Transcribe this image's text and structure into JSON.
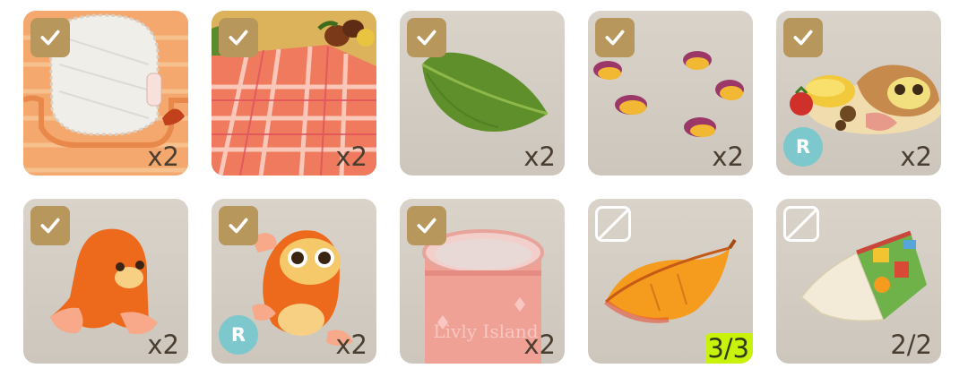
{
  "items": [
    {
      "name": "Lace Tablecloth Rug",
      "count": "x2",
      "collected": true,
      "badge": null
    },
    {
      "name": "Plaid Picnic Blanket",
      "count": "x2",
      "collected": true,
      "badge": null
    },
    {
      "name": "Green Leaf",
      "count": "x2",
      "collected": true,
      "badge": null
    },
    {
      "name": "Sweet Potato Slices",
      "count": "x2",
      "collected": true,
      "badge": null
    },
    {
      "name": "Autumn Feast Plate",
      "count": "x2",
      "collected": true,
      "badge": "R"
    },
    {
      "name": "Orange Blob Critter",
      "count": "x2",
      "collected": true,
      "badge": null
    },
    {
      "name": "Orange Squirrel Critter",
      "count": "x2",
      "collected": true,
      "badge": "R"
    },
    {
      "name": "Livly Island Jar",
      "count": "x2",
      "collected": true,
      "badge": null,
      "jar_text": "Livly Island"
    },
    {
      "name": "Autumn Orange Leaf",
      "count": "3/3",
      "collected": false,
      "badge": null,
      "highlight": true
    },
    {
      "name": "Open Picture Book",
      "count": "2/2",
      "collected": false,
      "badge": null
    }
  ],
  "colors": {
    "tile_bg": "#d4cdc3",
    "check_bg": "#b8975c",
    "badge_r": "#7cc8cc",
    "count_text": "#4a3e31",
    "highlight": "#c9f20a"
  }
}
